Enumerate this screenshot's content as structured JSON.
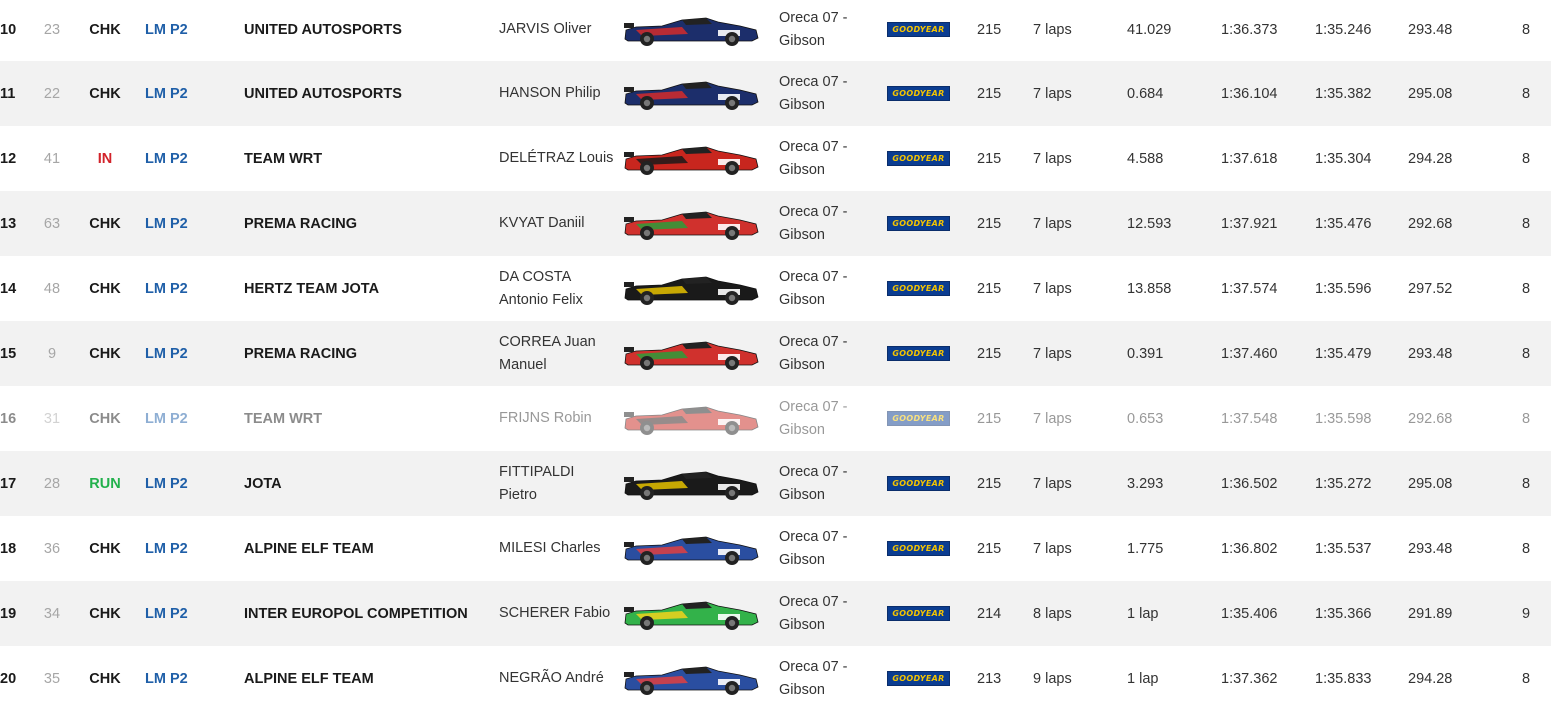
{
  "tyre_label": "GOODYEAR",
  "colors": {
    "class_blue": "#1f5fa8",
    "state_in": "#d2232a",
    "state_run": "#22b14c",
    "row_alt": "#f2f2f2",
    "tyre_blue": "#0b3d91",
    "tyre_yellow": "#f5c400"
  },
  "rows": [
    {
      "pos": "10",
      "num": "23",
      "state": "CHK",
      "cls": "LM P2",
      "team": "UNITED AUTOSPORTS",
      "driver": "JARVIS Oliver",
      "car_icon": "united-autosports-car",
      "car_color": "#1c2e6b",
      "accent": "#d42a2a",
      "chassis": "Oreca 07 - Gibson",
      "laps": "215",
      "gap1": "7 laps",
      "gap2": "41.029",
      "last": "1:36.373",
      "best": "1:35.246",
      "speed": "293.48",
      "pits": "8"
    },
    {
      "pos": "11",
      "num": "22",
      "state": "CHK",
      "cls": "LM P2",
      "team": "UNITED AUTOSPORTS",
      "driver": "HANSON Philip",
      "car_icon": "united-autosports-car",
      "car_color": "#1c2e6b",
      "accent": "#d42a2a",
      "chassis": "Oreca 07 - Gibson",
      "laps": "215",
      "gap1": "7 laps",
      "gap2": "0.684",
      "last": "1:36.104",
      "best": "1:35.382",
      "speed": "295.08",
      "pits": "8"
    },
    {
      "pos": "12",
      "num": "41",
      "state": "IN",
      "cls": "LM P2",
      "team": "TEAM WRT",
      "driver": "DELÉTRAZ Louis",
      "car_icon": "wrt-car",
      "car_color": "#c8261e",
      "accent": "#1a1a1a",
      "chassis": "Oreca 07 - Gibson",
      "laps": "215",
      "gap1": "7 laps",
      "gap2": "4.588",
      "last": "1:37.618",
      "best": "1:35.304",
      "speed": "294.28",
      "pits": "8"
    },
    {
      "pos": "13",
      "num": "63",
      "state": "CHK",
      "cls": "LM P2",
      "team": "PREMA RACING",
      "driver": "KVYAT Daniil",
      "car_icon": "prema-car",
      "car_color": "#d0312d",
      "accent": "#2a9d3a",
      "chassis": "Oreca 07 - Gibson",
      "laps": "215",
      "gap1": "7 laps",
      "gap2": "12.593",
      "last": "1:37.921",
      "best": "1:35.476",
      "speed": "292.68",
      "pits": "8"
    },
    {
      "pos": "14",
      "num": "48",
      "state": "CHK",
      "cls": "LM P2",
      "team": "HERTZ TEAM JOTA",
      "driver": "DA COSTA Antonio Felix",
      "car_icon": "jota-car",
      "car_color": "#1a1a1a",
      "accent": "#e6c200",
      "chassis": "Oreca 07 - Gibson",
      "laps": "215",
      "gap1": "7 laps",
      "gap2": "13.858",
      "last": "1:37.574",
      "best": "1:35.596",
      "speed": "297.52",
      "pits": "8"
    },
    {
      "pos": "15",
      "num": "9",
      "state": "CHK",
      "cls": "LM P2",
      "team": "PREMA RACING",
      "driver": "CORREA Juan Manuel",
      "car_icon": "prema-car",
      "car_color": "#d0312d",
      "accent": "#2a9d3a",
      "chassis": "Oreca 07 - Gibson",
      "laps": "215",
      "gap1": "7 laps",
      "gap2": "0.391",
      "last": "1:37.460",
      "best": "1:35.479",
      "speed": "293.48",
      "pits": "8"
    },
    {
      "pos": "16",
      "num": "31",
      "state": "CHK",
      "cls": "LM P2",
      "team": "TEAM WRT",
      "driver": "FRIJNS Robin",
      "car_icon": "wrt-car",
      "car_color": "#c8261e",
      "accent": "#1a1a1a",
      "chassis": "Oreca 07 - Gibson",
      "laps": "215",
      "gap1": "7 laps",
      "gap2": "0.653",
      "last": "1:37.548",
      "best": "1:35.598",
      "speed": "292.68",
      "pits": "8",
      "faded": true
    },
    {
      "pos": "17",
      "num": "28",
      "state": "RUN",
      "cls": "LM P2",
      "team": "JOTA",
      "driver": "FITTIPALDI Pietro",
      "car_icon": "jota-car",
      "car_color": "#1a1a1a",
      "accent": "#e6c200",
      "chassis": "Oreca 07 - Gibson",
      "laps": "215",
      "gap1": "7 laps",
      "gap2": "3.293",
      "last": "1:36.502",
      "best": "1:35.272",
      "speed": "295.08",
      "pits": "8"
    },
    {
      "pos": "18",
      "num": "36",
      "state": "CHK",
      "cls": "LM P2",
      "team": "ALPINE ELF TEAM",
      "driver": "MILESI Charles",
      "car_icon": "alpine-car",
      "car_color": "#2a4ea0",
      "accent": "#e04040",
      "chassis": "Oreca 07 - Gibson",
      "laps": "215",
      "gap1": "7 laps",
      "gap2": "1.775",
      "last": "1:36.802",
      "best": "1:35.537",
      "speed": "293.48",
      "pits": "8"
    },
    {
      "pos": "19",
      "num": "34",
      "state": "CHK",
      "cls": "LM P2",
      "team": "INTER EUROPOL COMPETITION",
      "driver": "SCHERER Fabio",
      "car_icon": "inter-europol-car",
      "car_color": "#33b24a",
      "accent": "#f2d21b",
      "chassis": "Oreca 07 - Gibson",
      "laps": "214",
      "gap1": "8 laps",
      "gap2": "1 lap",
      "last": "1:35.406",
      "best": "1:35.366",
      "speed": "291.89",
      "pits": "9"
    },
    {
      "pos": "20",
      "num": "35",
      "state": "CHK",
      "cls": "LM P2",
      "team": "ALPINE ELF TEAM",
      "driver": "NEGRÃO André",
      "car_icon": "alpine-car",
      "car_color": "#2a4ea0",
      "accent": "#e04040",
      "chassis": "Oreca 07 - Gibson",
      "laps": "213",
      "gap1": "9 laps",
      "gap2": "1 lap",
      "last": "1:37.362",
      "best": "1:35.833",
      "speed": "294.28",
      "pits": "8"
    }
  ]
}
